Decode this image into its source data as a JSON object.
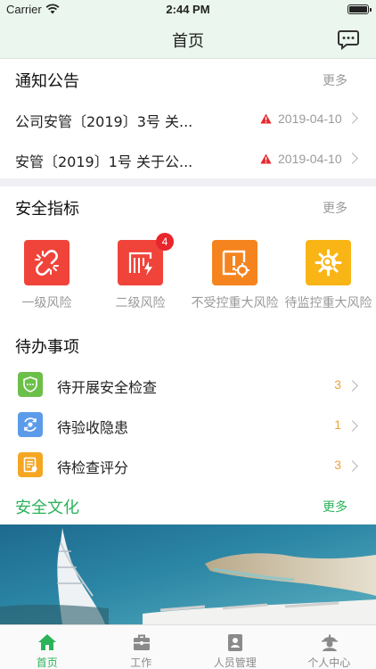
{
  "status_bar": {
    "carrier": "Carrier",
    "time": "2:44 PM"
  },
  "nav": {
    "title": "首页",
    "message_icon": "chat-bubble-icon"
  },
  "notices": {
    "title": "通知公告",
    "more": "更多",
    "items": [
      {
        "text": "公司安管〔2019〕3号 关...",
        "date": "2019-04-10"
      },
      {
        "text": "安管〔2019〕1号 关于公...",
        "date": "2019-04-10"
      }
    ]
  },
  "indicators": {
    "title": "安全指标",
    "more": "更多",
    "items": [
      {
        "label": "一级风险",
        "color": "#f0443a",
        "icon": "broken-link-icon",
        "badge": ""
      },
      {
        "label": "二级风险",
        "color": "#f0443a",
        "icon": "power-warning-icon",
        "badge": "4"
      },
      {
        "label": "不受控重大风险",
        "color": "#f5841f",
        "icon": "alert-gear-icon",
        "badge": ""
      },
      {
        "label": "待监控重大风险",
        "color": "#f9b416",
        "icon": "gear-search-icon",
        "badge": ""
      }
    ]
  },
  "todos": {
    "title": "待办事项",
    "items": [
      {
        "label": "待开展安全检查",
        "count": "3",
        "color": "#6cc04a",
        "icon": "shield-check-icon"
      },
      {
        "label": "待验收隐患",
        "count": "1",
        "color": "#5b9bea",
        "icon": "eye-sync-icon"
      },
      {
        "label": "待检查评分",
        "count": "3",
        "color": "#f5a623",
        "icon": "score-sheet-icon"
      }
    ]
  },
  "culture": {
    "title": "安全文化",
    "more": "更多"
  },
  "colors": {
    "accent": "#2bb35a",
    "header_bg": "#eaf6ee",
    "count": "#f0a23b",
    "badge": "#e8262b"
  },
  "tabs": [
    {
      "label": "首页",
      "icon": "home-icon",
      "active": true
    },
    {
      "label": "工作",
      "icon": "briefcase-icon",
      "active": false
    },
    {
      "label": "人员管理",
      "icon": "contact-card-icon",
      "active": false
    },
    {
      "label": "个人中心",
      "icon": "person-helmet-icon",
      "active": false
    }
  ]
}
